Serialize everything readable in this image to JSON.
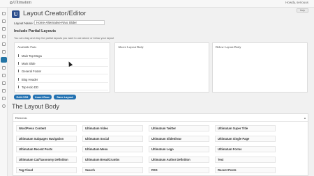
{
  "adminbar": {
    "site_name": "Ultimatum",
    "howdy": "Howdy, seriouus"
  },
  "help_label": "Help",
  "header": {
    "logo_letter": "U",
    "title": "Layout Creator/Editor"
  },
  "layout_name": {
    "label": "Layout Name:",
    "value": "Home-Alternative-Nivo Slider"
  },
  "partial_layouts": {
    "heading": "Include Partial Layouts",
    "description": "You can drag and drop the partial layouts you want to use above or below your layout"
  },
  "panels": {
    "available": "Available Parts",
    "above": "Above Layout Body",
    "below": "Below Layout Body"
  },
  "available_parts": [
    "Main Top-Mega",
    "Main Slide",
    "General Footer",
    "Blog Header",
    "Top-Holo DD"
  ],
  "buttons": {
    "edit_css": "Edit CSS",
    "insert_row": "Insert Row",
    "save_layout": "Save Layout"
  },
  "layout_body_title": "The Layout Body",
  "elements": {
    "title": "Elements",
    "items": [
      [
        "WordPress Content",
        "Ultimatum Video",
        "Ultimatum Twitter",
        "Ultimatum Super Title"
      ],
      [
        "Ultimatum Subpages Navigation",
        "Ultimatum Social",
        "Ultimatum SlideShow",
        "Ultimatum Single Page"
      ],
      [
        "Ultimatum Recent Posts",
        "Ultimatum Menu",
        "Ultimatum Logo",
        "Ultimatum Forms"
      ],
      [
        "Ultimatum Cat/Taxonomy Definition",
        "Ultimatum BreadCrumbs",
        "Ultimatum Author Definition",
        "Text"
      ],
      [
        "Tag Cloud",
        "Search",
        "RSS",
        "Recent Posts"
      ]
    ]
  }
}
